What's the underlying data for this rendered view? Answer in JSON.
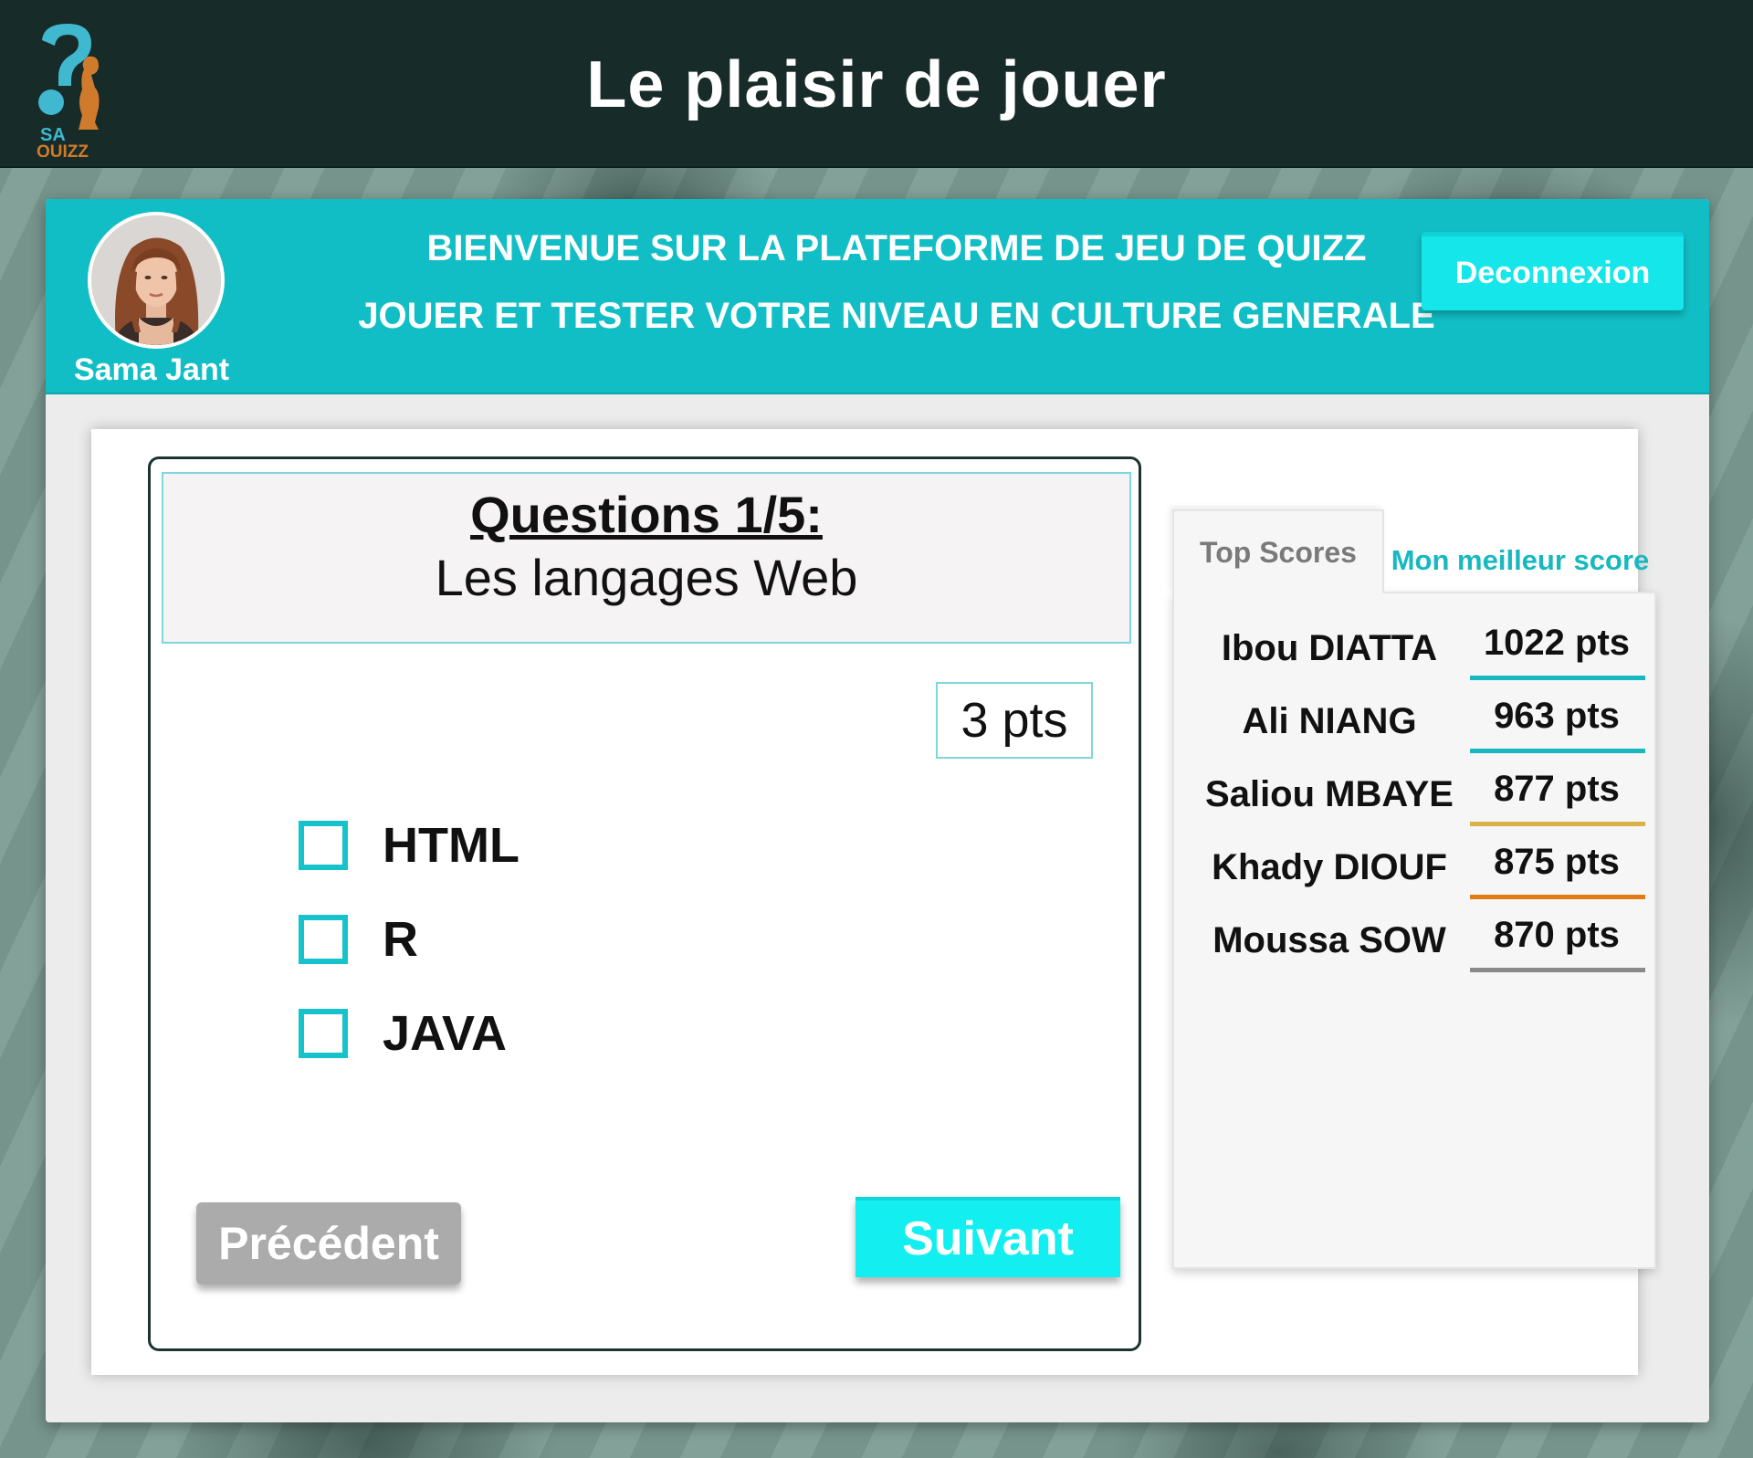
{
  "topbar": {
    "logo_text_top": "SA",
    "logo_text_bottom": "QUIZZ",
    "title": "Le plaisir de jouer"
  },
  "header": {
    "user_name": "Sama Jant",
    "welcome_line_1": "BIENVENUE SUR LA PLATEFORME DE JEU DE QUIZZ",
    "welcome_line_2": "JOUER ET TESTER VOTRE NIVEAU EN CULTURE GENERALE",
    "logout_label": "Deconnexion"
  },
  "question": {
    "number_label": "Questions 1/5:",
    "topic": "Les langages Web",
    "points": "3 pts",
    "options": [
      {
        "label": "HTML",
        "checked": false
      },
      {
        "label": "R",
        "checked": false
      },
      {
        "label": "JAVA",
        "checked": false
      }
    ],
    "prev_label": "Précédent",
    "next_label": "Suivant"
  },
  "scores": {
    "tabs": [
      {
        "label": "Top Scores",
        "active": true
      },
      {
        "label": "Mon meilleur score",
        "active": false
      }
    ],
    "rows": [
      {
        "name": "Ibou DIATTA",
        "points": "1022 pts",
        "color": "#18b8c1"
      },
      {
        "name": "Ali NIANG",
        "points": "963 pts",
        "color": "#18b8c1"
      },
      {
        "name": "Saliou MBAYE",
        "points": "877 pts",
        "color": "#d9b34a"
      },
      {
        "name": "Khady DIOUF",
        "points": "875 pts",
        "color": "#e07b16"
      },
      {
        "name": "Moussa SOW",
        "points": "870 pts",
        "color": "#8a8a8a"
      }
    ]
  },
  "colors": {
    "topbar": "#172b28",
    "accent": "#12bec6",
    "button_cyan": "#14e6ea",
    "button_gray": "#ababab"
  },
  "icons": [
    "logo-icon",
    "avatar-image",
    "checkbox-icon"
  ]
}
